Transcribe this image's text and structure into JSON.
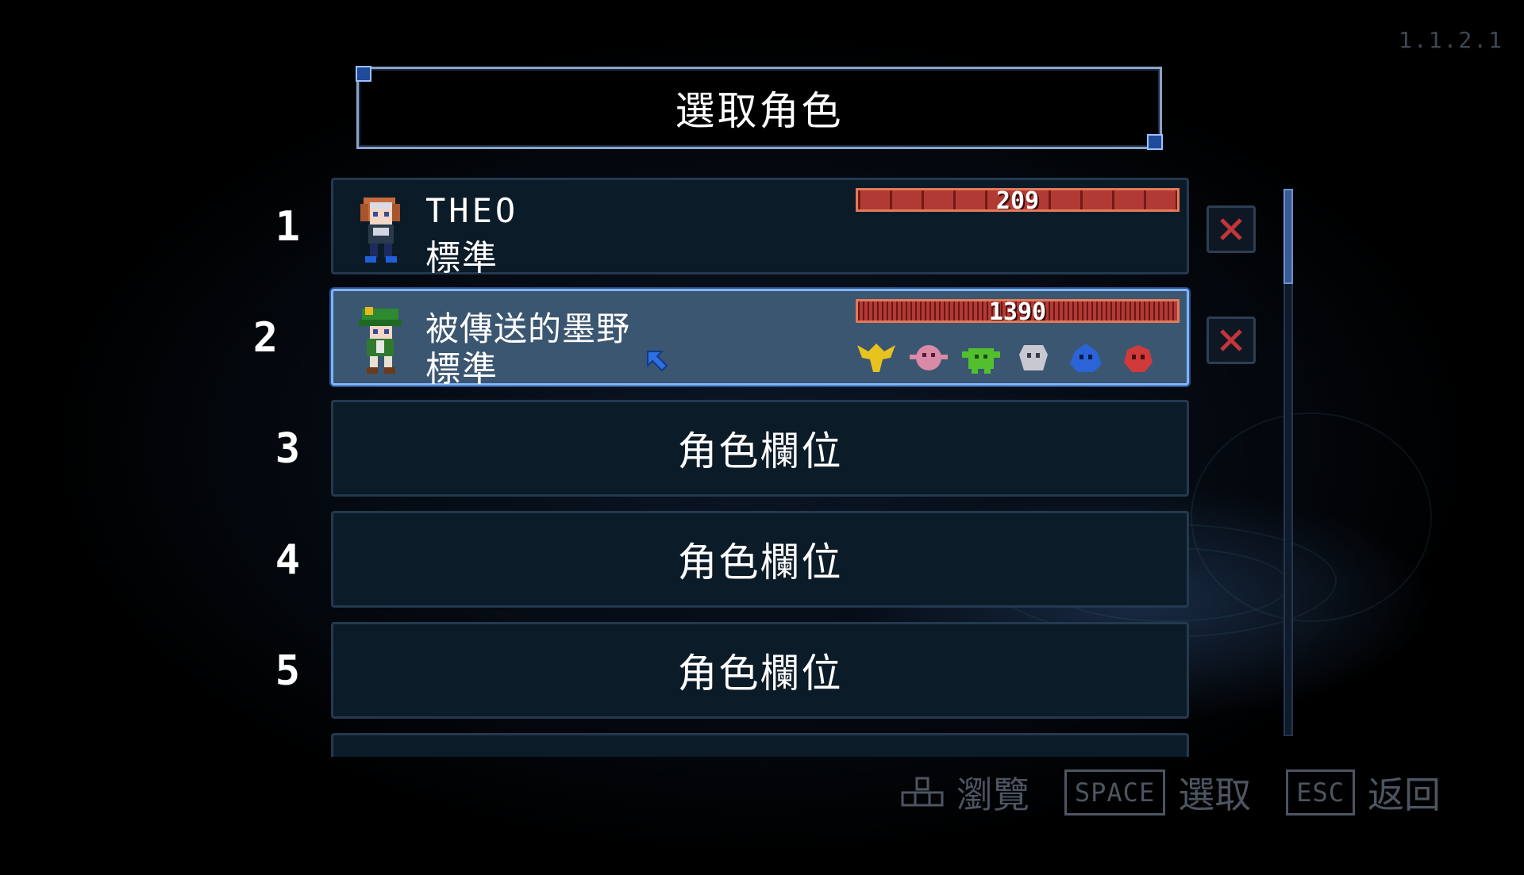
{
  "version": "1.1.2.1",
  "title": "選取角色",
  "slots": [
    {
      "number": "1",
      "name": "THEO",
      "mode": "標準",
      "score": "209",
      "selected": false
    },
    {
      "number": "2",
      "name": "被傳送的墨野",
      "mode": "標準",
      "score": "1390",
      "selected": true,
      "bosses": [
        "gold-boss-icon",
        "pink-boss-icon",
        "green-boss-icon",
        "white-boss-icon",
        "blue-boss-icon",
        "red-boss-icon"
      ]
    },
    {
      "number": "3",
      "label": "角色欄位"
    },
    {
      "number": "4",
      "label": "角色欄位"
    },
    {
      "number": "5",
      "label": "角色欄位"
    }
  ],
  "hints": {
    "browse": "瀏覽",
    "select_key": "SPACE",
    "select": "選取",
    "back_key": "ESC",
    "back": "返回"
  },
  "colors": {
    "score_bar": "#b23a35",
    "selected_border": "#7fb4ff",
    "delete_x": "#c2353a"
  }
}
